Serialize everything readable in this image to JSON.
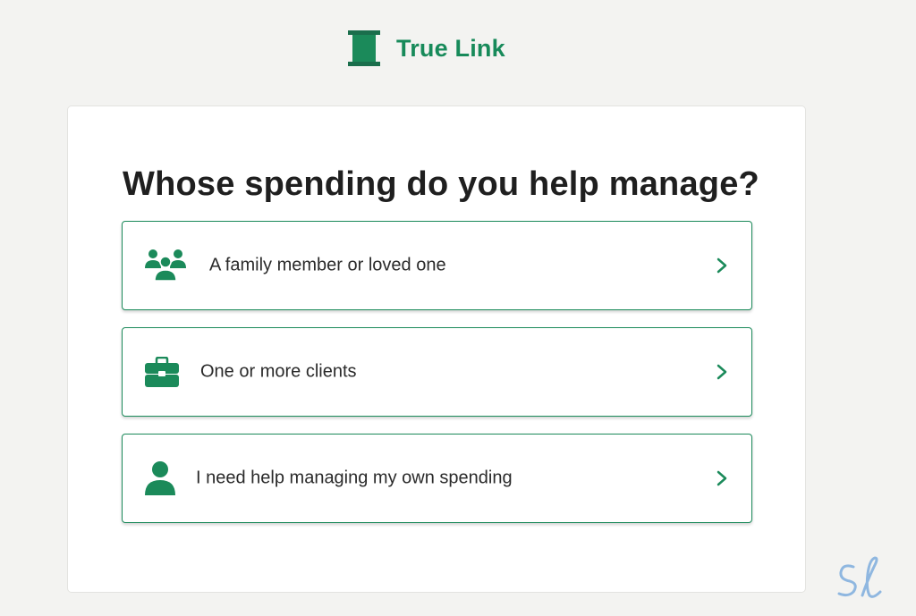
{
  "brand": {
    "name": "True Link",
    "color": "#178a5a",
    "icon": "spool-icon"
  },
  "card": {
    "question": "Whose spending do you help manage?",
    "options": [
      {
        "label": "A family member or loved one",
        "icon": "group-people-icon"
      },
      {
        "label": "One or more clients",
        "icon": "briefcase-icon"
      },
      {
        "label": "I need help managing my own spending",
        "icon": "person-icon"
      }
    ]
  },
  "colors": {
    "accent": "#1b8a5a",
    "background": "#f3f3f1",
    "card": "#ffffff",
    "text": "#1f1f1f"
  },
  "watermark": {
    "icon": "script-sl-logo"
  }
}
